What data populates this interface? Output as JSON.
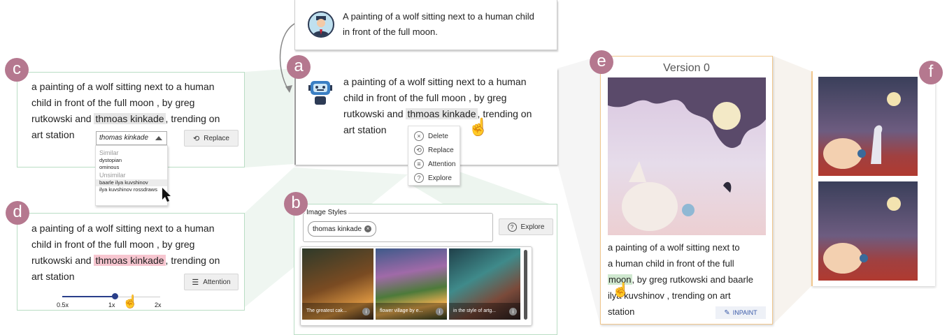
{
  "badges": {
    "a": "a",
    "b": "b",
    "c": "c",
    "d": "d",
    "e": "e",
    "f": "f"
  },
  "user_prompt": {
    "line1": "A painting of a wolf sitting next to a human child",
    "line2": "in front of the full moon."
  },
  "panel_a": {
    "line1": "a painting of a wolf sitting next to a human",
    "line2": "child in front of the full moon , by greg",
    "line3_pre": "rutkowski and ",
    "highlight": "thmoas kinkade",
    ", trending on": "",
    "line3_post": ", trending on",
    "line4": "art station",
    "menu": [
      "Delete",
      "Replace",
      "Attention",
      "Explore"
    ]
  },
  "panel_c": {
    "line1": "a painting of a wolf sitting next to a human",
    "line2": "child in front of the full moon , by greg",
    "line3_pre": "rutkowski and ",
    "highlight": "thmoas kinkade",
    "line3_post": ", trending on",
    "line4": "art station",
    "dropdown_value": "thomas kinkade",
    "replace_label": "Replace",
    "similar_header": "Similar",
    "similar": [
      "dystopian",
      "ominous"
    ],
    "unsimilar_header": "Unsimilar",
    "unsimilar": [
      "baarle ilya kuvshinov",
      "ilya kuvshinov rossdraws"
    ]
  },
  "panel_d": {
    "line1": "a painting of a wolf sitting next to a human",
    "line2": "child in front of the full moon , by greg",
    "line3_pre": "rutkowski and ",
    "highlight": "thmoas kinkade",
    "line3_post": ", trending on",
    "line4": "art station",
    "attention_label": "Attention",
    "slider_ticks": [
      "0.5x",
      "1x",
      "2x"
    ],
    "slider_value": 1.3
  },
  "panel_b": {
    "legend": "Image Styles",
    "chip": "thomas kinkade",
    "explore_label": "Explore",
    "thumbs": [
      "The greatest cak...",
      "flower village by e...",
      "in the style of artg..."
    ]
  },
  "panel_e": {
    "version": "Version 0",
    "line1": "a painting of a wolf sitting next to",
    "line2": "a human child in front of the full",
    "line3_hl": "moon",
    "line3_post": ", by greg rutkowski and baarle",
    "line4": "ilya kuvshinov ,  trending  on  art",
    "line5": "station",
    "inpaint_label": "INPAINT"
  },
  "colors": {
    "badge": "#b5788f",
    "green_border": "#b9ddc4",
    "orange_border": "#f1c78d"
  }
}
